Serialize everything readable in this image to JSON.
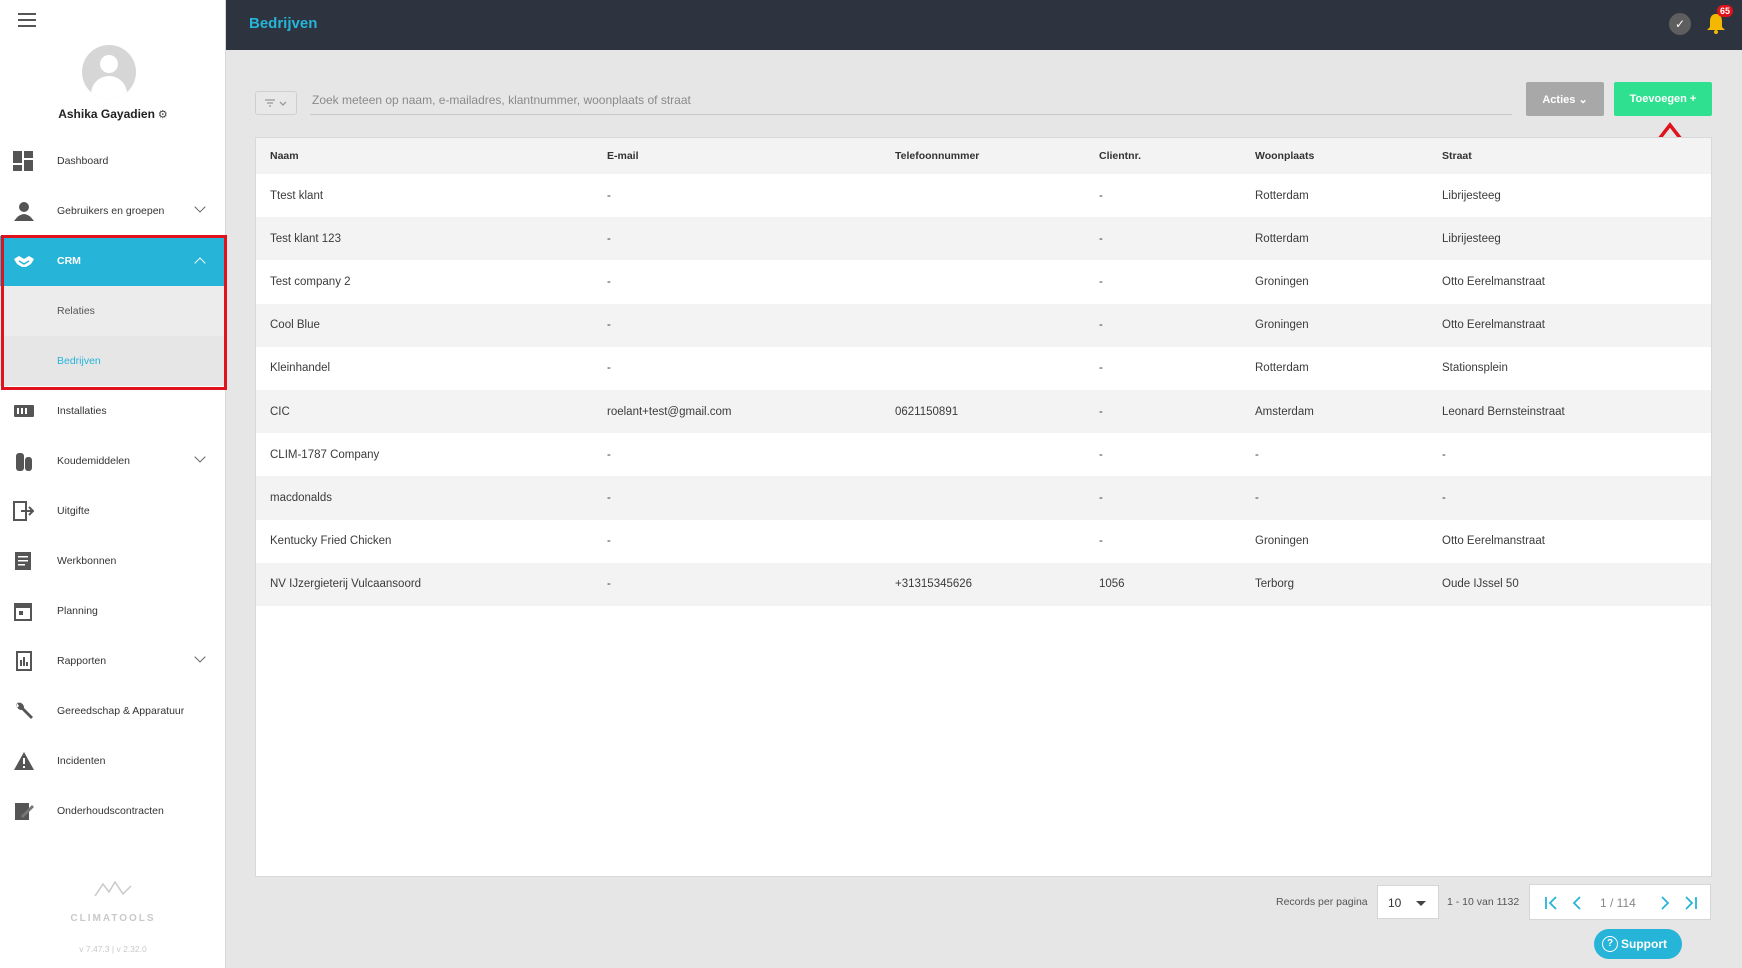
{
  "sidebar": {
    "user_name": "Ashika Gayadien",
    "items": [
      {
        "label": "Dashboard",
        "icon": "dashboard-icon"
      },
      {
        "label": "Gebruikers en groepen",
        "icon": "user-icon"
      },
      {
        "label": "CRM",
        "icon": "handshake-icon"
      },
      {
        "label": "Installaties",
        "icon": "installation-icon"
      },
      {
        "label": "Koudemiddelen",
        "icon": "refrigerant-icon"
      },
      {
        "label": "Uitgifte",
        "icon": "exit-icon"
      },
      {
        "label": "Werkbonnen",
        "icon": "workorder-icon"
      },
      {
        "label": "Planning",
        "icon": "calendar-icon"
      },
      {
        "label": "Rapporten",
        "icon": "reports-icon"
      },
      {
        "label": "Gereedschap & Apparatuur",
        "icon": "wrench-icon"
      },
      {
        "label": "Incidenten",
        "icon": "warning-icon"
      },
      {
        "label": "Onderhoudscontracten",
        "icon": "contract-icon"
      }
    ],
    "crm_sub": [
      {
        "label": "Relaties"
      },
      {
        "label": "Bedrijven"
      }
    ],
    "brand": "CLIMATOOLS",
    "version": "v 7.47.3  | v 2.32.0"
  },
  "header": {
    "title": "Bedrijven",
    "notification_count": "65"
  },
  "toolbar": {
    "search_placeholder": "Zoek meteen op naam, e-mailadres, klantnummer, woonplaats of straat",
    "acties_label": "Acties",
    "add_label": "Toevoegen +"
  },
  "table": {
    "headers": [
      "Naam",
      "E-mail",
      "Telefoonnummer",
      "Clientnr.",
      "Woonplaats",
      "Straat"
    ],
    "rows": [
      [
        "Ttest klant",
        "-",
        "",
        "-",
        "Rotterdam",
        "Librijesteeg"
      ],
      [
        "Test klant 123",
        "-",
        "",
        "-",
        "Rotterdam",
        "Librijesteeg"
      ],
      [
        "Test company 2",
        "-",
        "",
        "-",
        "Groningen",
        "Otto Eerelmanstraat"
      ],
      [
        "Cool Blue",
        "-",
        "",
        "-",
        "Groningen",
        "Otto Eerelmanstraat"
      ],
      [
        "Kleinhandel",
        "-",
        "",
        "-",
        "Rotterdam",
        "Stationsplein"
      ],
      [
        "CIC",
        "roelant+test@gmail.com",
        "0621150891",
        "-",
        "Amsterdam",
        "Leonard Bernsteinstraat"
      ],
      [
        "CLIM-1787 Company",
        "-",
        "",
        "-",
        "-",
        "-"
      ],
      [
        "macdonalds",
        "-",
        "",
        "-",
        "-",
        "-"
      ],
      [
        "Kentucky Fried Chicken",
        "-",
        "",
        "-",
        "Groningen",
        "Otto Eerelmanstraat"
      ],
      [
        "NV IJzergieterij Vulcaansoord",
        "-",
        "+31315345626",
        "1056",
        "Terborg",
        "Oude IJssel 50"
      ]
    ]
  },
  "pagination": {
    "records_label": "Records per pagina",
    "per_page": "10",
    "range": "1 - 10 van 1132",
    "page": "1 / 114"
  },
  "support_label": "Support",
  "colors": {
    "accent": "#26b4d8",
    "header_bg": "#2d3440",
    "add_button": "#2ee08f",
    "highlight_red": "#e0131d"
  }
}
